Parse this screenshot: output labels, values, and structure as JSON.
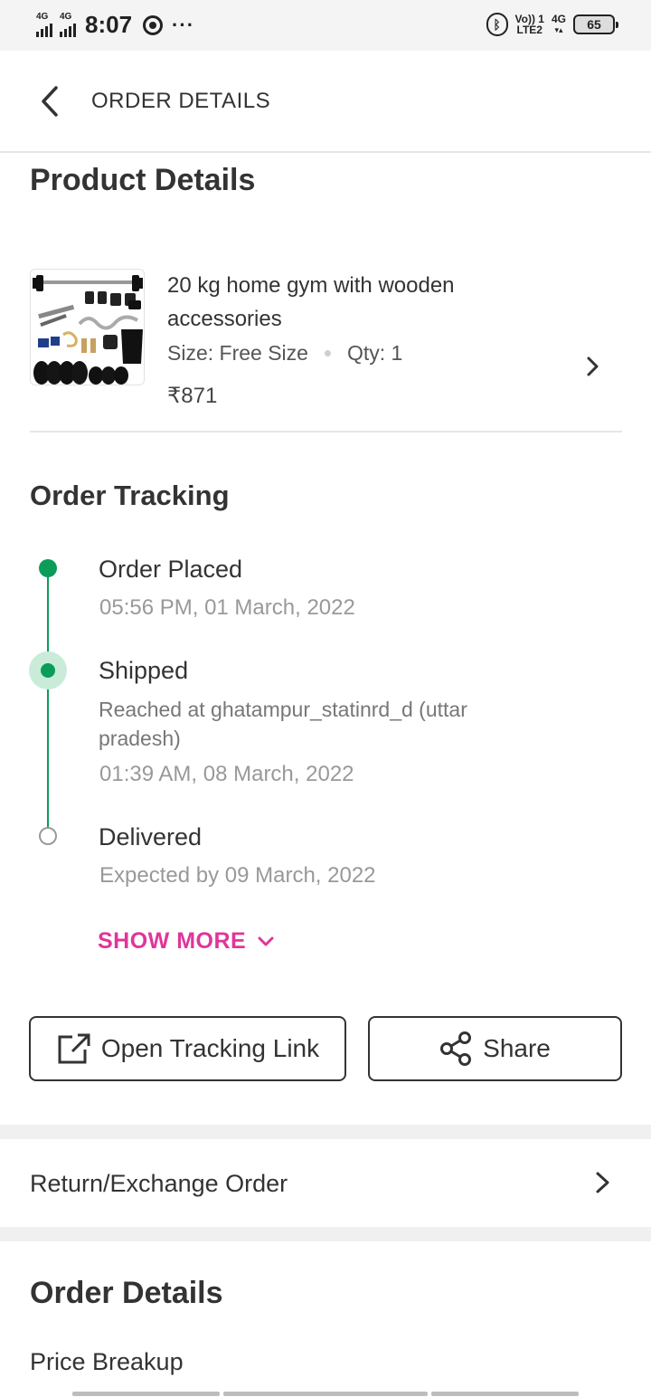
{
  "status_bar": {
    "network1": "4G",
    "network2": "4G",
    "time": "8:07",
    "overflow": "···",
    "volte": "Vo)) 1",
    "lte": "LTE2",
    "net4g": "4G",
    "battery": "65"
  },
  "header": {
    "title": "ORDER DETAILS"
  },
  "product_section": {
    "title": "Product Details",
    "name": "20 kg home gym with wooden accessories",
    "size": "Size: Free Size",
    "qty": "Qty: 1",
    "price": "₹871"
  },
  "tracking": {
    "title": "Order Tracking",
    "steps": [
      {
        "title": "Order Placed",
        "time": "05:56 PM, 01 March, 2022",
        "status": "completed"
      },
      {
        "title": "Shipped",
        "detail": "Reached at ghatampur_statinrd_d (uttar pradesh)",
        "time": "01:39 AM, 08 March, 2022",
        "status": "current"
      },
      {
        "title": "Delivered",
        "time": "Expected by 09 March, 2022",
        "status": "pending"
      }
    ],
    "show_more": "SHOW MORE"
  },
  "actions": {
    "open_tracking": "Open Tracking Link",
    "share": "Share"
  },
  "return_exchange": {
    "label": "Return/Exchange Order"
  },
  "order_details": {
    "title": "Order Details",
    "price_breakup": "Price Breakup"
  },
  "colors": {
    "accent_green": "#0a9d58",
    "accent_pink": "#e0359a",
    "text": "#333333"
  },
  "icons": [
    "back-chevron-icon",
    "chevron-right-icon",
    "chevron-down-icon",
    "external-link-icon",
    "share-icon",
    "bluetooth-icon",
    "battery-icon",
    "chrome-icon"
  ]
}
